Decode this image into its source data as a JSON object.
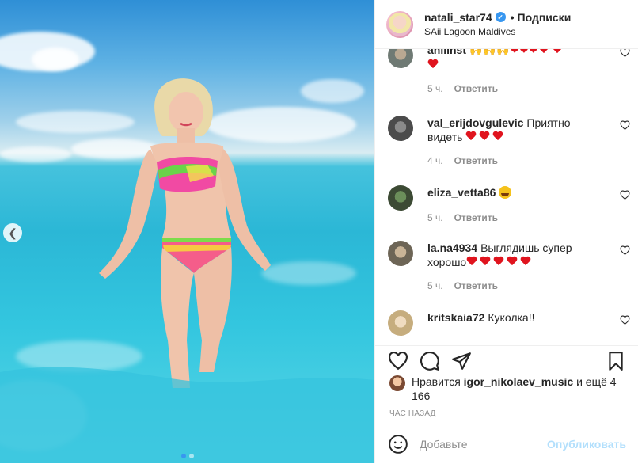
{
  "post": {
    "author": {
      "username": "natali_star74",
      "verified": true,
      "follow_label": "Подписки",
      "separator": "•",
      "location": "SAii Lagoon Maldives"
    },
    "image": {
      "carousel_dots": 2,
      "active_dot": 1
    }
  },
  "comments": [
    {
      "user": "anilinst",
      "text": "",
      "emoji": [
        "raised-hands",
        "raised-hands",
        "raised-hands",
        "heart-fire",
        "heart-fire",
        "heart-fire",
        "red-heart",
        "red-heart",
        "red-heart"
      ],
      "time": "5 ч.",
      "reply": "Ответить"
    },
    {
      "user": "val_erijdovgulevic",
      "text": "Приятно видеть",
      "emoji": [
        "red-heart",
        "red-heart",
        "red-heart"
      ],
      "time": "4 ч.",
      "reply": "Ответить"
    },
    {
      "user": "eliza_vetta86",
      "text": "",
      "emoji": [
        "heart-eyes"
      ],
      "time": "5 ч.",
      "reply": "Ответить"
    },
    {
      "user": "la.na4934",
      "text": "Выглядишь супер хорошо",
      "emoji": [
        "red-heart",
        "red-heart",
        "red-heart",
        "red-heart",
        "red-heart"
      ],
      "time": "5 ч.",
      "reply": "Ответить"
    },
    {
      "user": "kritskaia72",
      "text": "Куколка!!",
      "emoji": [],
      "time": "",
      "reply": ""
    }
  ],
  "actions": {
    "likes_prefix": "Нравится",
    "likes_user": "igor_nikolaev_music",
    "likes_suffix": "и ещё 4 166",
    "time_ago": "ЧАС НАЗАД"
  },
  "add_comment": {
    "placeholder": "Добавьте",
    "publish_label": "Опубликовать"
  },
  "colors": {
    "accent": "#3897f0",
    "publish_disabled": "#b2dffc",
    "heart": "#e0141e",
    "muted": "#8e8e8e"
  }
}
